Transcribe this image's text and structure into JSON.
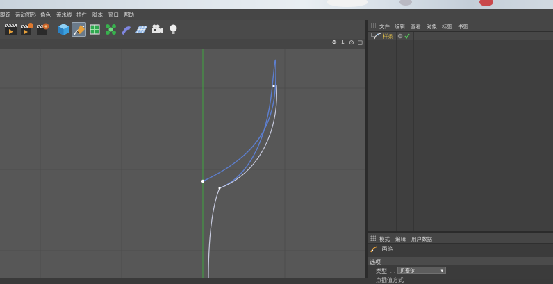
{
  "menubar": {
    "items": [
      "跟踪",
      "运动图形",
      "角色",
      "流水线",
      "插件",
      "脚本",
      "窗口",
      "帮助"
    ]
  },
  "toolbar": {
    "buttons": [
      {
        "name": "render-view-icon"
      },
      {
        "name": "render-to-picture-viewer-icon"
      },
      {
        "name": "render-settings-icon"
      },
      {
        "name": "cube-icon"
      },
      {
        "name": "pen-spline-icon"
      },
      {
        "name": "subdivision-surface-icon"
      },
      {
        "name": "cloner-icon"
      },
      {
        "name": "bend-deformer-icon"
      },
      {
        "name": "floor-icon"
      },
      {
        "name": "camera-icon"
      },
      {
        "name": "light-icon"
      }
    ],
    "active_index": 4
  },
  "viewport": {
    "nav_icons": "✥ ↓ ⊙ ◻"
  },
  "object_manager": {
    "menu": [
      "文件",
      "编辑",
      "查看",
      "对象",
      "标签",
      "书签"
    ],
    "objects": [
      {
        "name": "样条",
        "icon": "spline-object-icon"
      }
    ]
  },
  "attribute_manager": {
    "menu": [
      "模式",
      "编辑",
      "用户数据"
    ],
    "object_label": "画笔",
    "section": "选项",
    "type_label": "类型",
    "type_dots": ". . . . . . . .",
    "type_value": "贝塞尔",
    "next_label": "点插值方式"
  },
  "colors": {
    "accent": "#e5c24c",
    "spline_selected": "#5d7fd0",
    "spline": "#c8cbdf",
    "y_axis": "#3fa53f"
  }
}
